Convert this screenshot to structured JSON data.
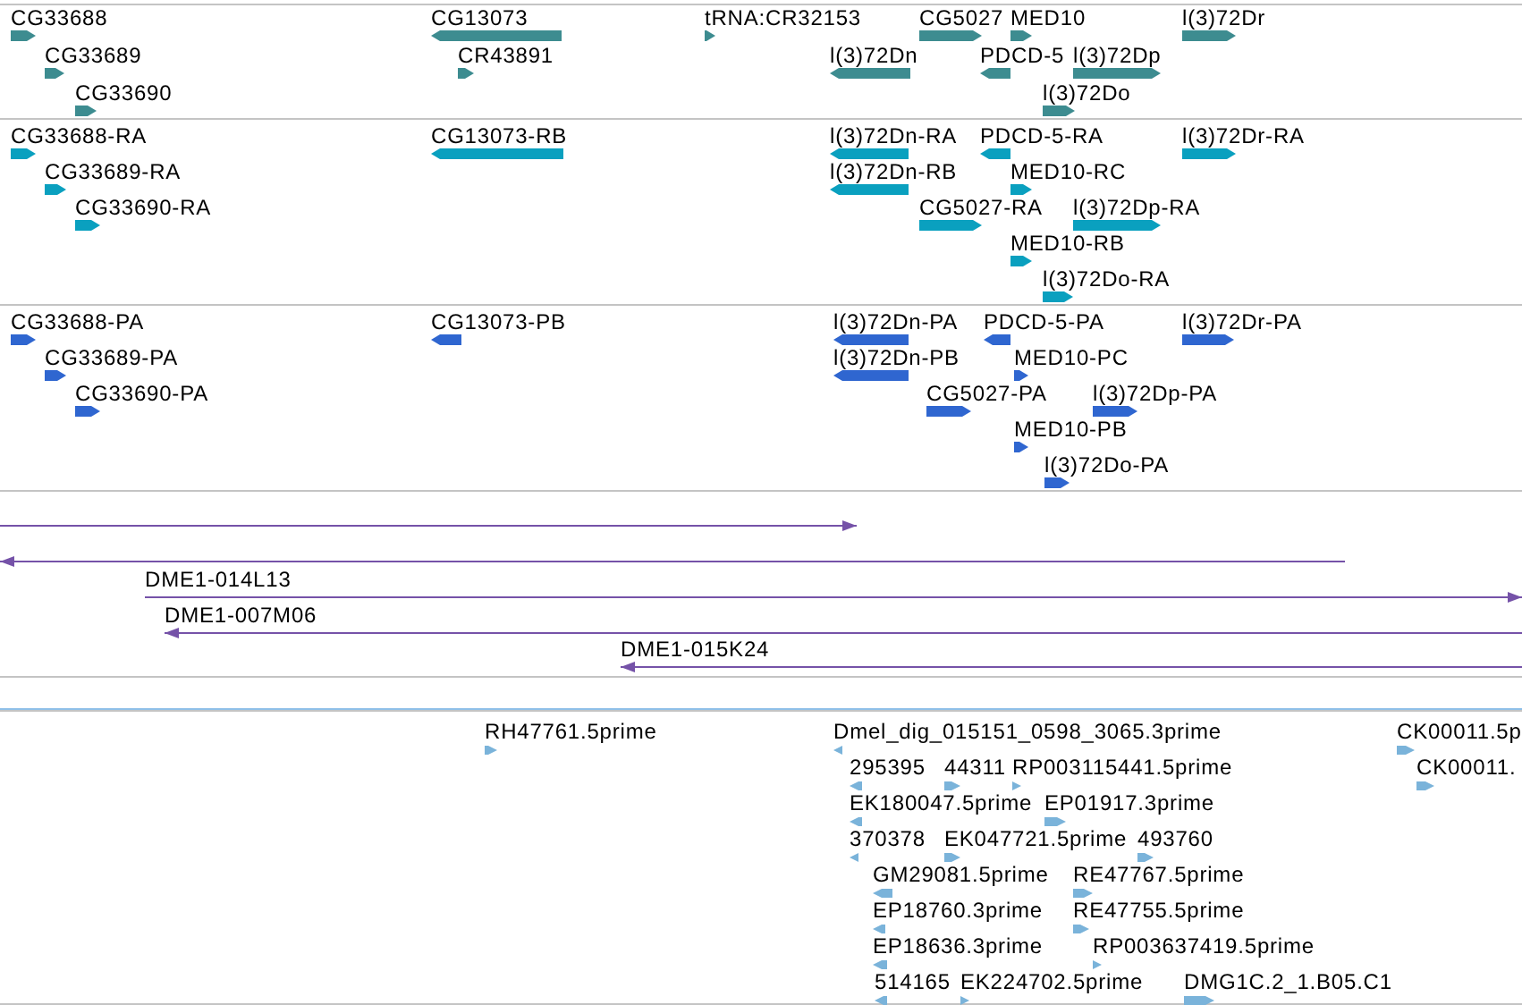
{
  "tracks": [
    {
      "kind": "gene",
      "features": [
        {
          "label": "CG33688",
          "reverse_strand": false
        },
        {
          "label": "CG13073",
          "reverse_strand": true
        },
        {
          "label": "tRNA:CR32153",
          "reverse_strand": false
        },
        {
          "label": "CG5027",
          "reverse_strand": false
        },
        {
          "label": "MED10",
          "reverse_strand": false
        },
        {
          "label": "l(3)72Dr",
          "reverse_strand": false
        },
        {
          "label": "CG33689",
          "reverse_strand": false
        },
        {
          "label": "CR43891",
          "reverse_strand": false
        },
        {
          "label": "l(3)72Dn",
          "reverse_strand": true
        },
        {
          "label": "PDCD-5",
          "reverse_strand": true
        },
        {
          "label": "l(3)72Dp",
          "reverse_strand": false
        },
        {
          "label": "CG33690",
          "reverse_strand": false
        },
        {
          "label": "l(3)72Do",
          "reverse_strand": false
        }
      ]
    },
    {
      "kind": "transcript",
      "features": [
        {
          "label": "CG33688-RA",
          "reverse_strand": false
        },
        {
          "label": "CG13073-RB",
          "reverse_strand": true
        },
        {
          "label": "l(3)72Dn-RA",
          "reverse_strand": true
        },
        {
          "label": "PDCD-5-RA",
          "reverse_strand": true
        },
        {
          "label": "l(3)72Dr-RA",
          "reverse_strand": false
        },
        {
          "label": "CG33689-RA",
          "reverse_strand": false
        },
        {
          "label": "l(3)72Dn-RB",
          "reverse_strand": true
        },
        {
          "label": "MED10-RC",
          "reverse_strand": false
        },
        {
          "label": "CG33690-RA",
          "reverse_strand": false
        },
        {
          "label": "CG5027-RA",
          "reverse_strand": false
        },
        {
          "label": "l(3)72Dp-RA",
          "reverse_strand": false
        },
        {
          "label": "MED10-RB",
          "reverse_strand": false
        },
        {
          "label": "l(3)72Do-RA",
          "reverse_strand": false
        }
      ]
    },
    {
      "kind": "protein",
      "features": [
        {
          "label": "CG33688-PA",
          "reverse_strand": false
        },
        {
          "label": "CG13073-PB",
          "reverse_strand": true
        },
        {
          "label": "l(3)72Dn-PA",
          "reverse_strand": true
        },
        {
          "label": "PDCD-5-PA",
          "reverse_strand": true
        },
        {
          "label": "l(3)72Dr-PA",
          "reverse_strand": false
        },
        {
          "label": "CG33689-PA",
          "reverse_strand": false
        },
        {
          "label": "l(3)72Dn-PB",
          "reverse_strand": true
        },
        {
          "label": "MED10-PC",
          "reverse_strand": false
        },
        {
          "label": "CG33690-PA",
          "reverse_strand": false
        },
        {
          "label": "CG5027-PA",
          "reverse_strand": false
        },
        {
          "label": "l(3)72Dp-PA",
          "reverse_strand": false
        },
        {
          "label": "MED10-PB",
          "reverse_strand": false
        },
        {
          "label": "l(3)72Do-PA",
          "reverse_strand": false
        }
      ]
    },
    {
      "kind": "clone",
      "features": [
        {
          "reverse_strand": false
        },
        {
          "reverse_strand": true
        },
        {
          "label": "DME1-014L13",
          "reverse_strand": false
        },
        {
          "label": "DME1-007M06",
          "reverse_strand": true
        },
        {
          "label": "DME1-015K24",
          "reverse_strand": true
        }
      ]
    },
    {
      "kind": "est",
      "features": [
        {
          "label": "RH47761.5prime",
          "reverse_strand": false
        },
        {
          "label": "Dmel_dig_015151_0598_3065.3prime",
          "reverse_strand": true
        },
        {
          "label": "CK00011.5p",
          "reverse_strand": false
        },
        {
          "label": "295395",
          "reverse_strand": true
        },
        {
          "label": "44311",
          "reverse_strand": false
        },
        {
          "label": "RP003115441.5prime",
          "reverse_strand": false
        },
        {
          "label": "CK00011.",
          "reverse_strand": false
        },
        {
          "label": "EK180047.5prime",
          "reverse_strand": true
        },
        {
          "label": "EP01917.3prime",
          "reverse_strand": false
        },
        {
          "label": "370378",
          "reverse_strand": true
        },
        {
          "label": "EK047721.5prime",
          "reverse_strand": false
        },
        {
          "label": "493760",
          "reverse_strand": false
        },
        {
          "label": "GM29081.5prime",
          "reverse_strand": true
        },
        {
          "label": "RE47767.5prime",
          "reverse_strand": false
        },
        {
          "label": "EP18760.3prime",
          "reverse_strand": true
        },
        {
          "label": "RE47755.5prime",
          "reverse_strand": false
        },
        {
          "label": "EP18636.3prime",
          "reverse_strand": true
        },
        {
          "label": "RP003637419.5prime",
          "reverse_strand": false
        },
        {
          "label": "514165",
          "reverse_strand": true
        },
        {
          "label": "EK224702.5prime",
          "reverse_strand": false
        },
        {
          "label": "DMG1C.2_1.B05.C1",
          "reverse_strand": false
        }
      ]
    }
  ]
}
